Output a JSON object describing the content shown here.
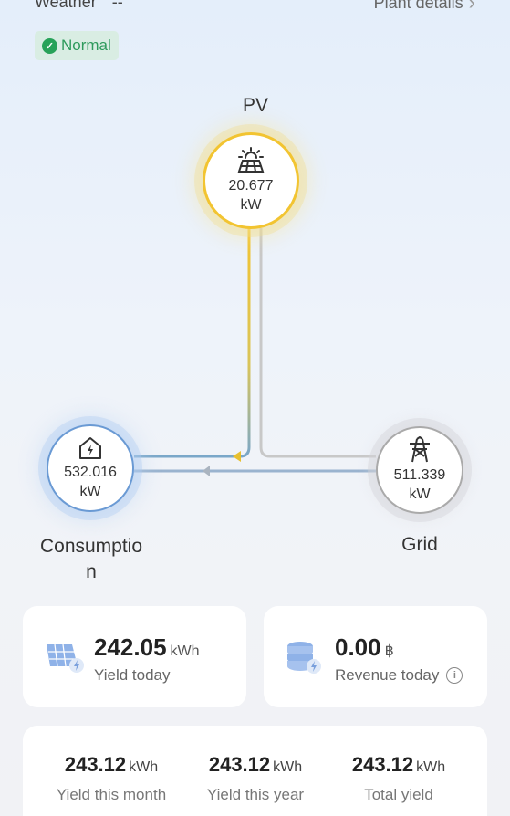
{
  "header": {
    "weather_label": "Weather",
    "weather_value": "--",
    "plant_details_label": "Plant details"
  },
  "status": {
    "label": "Normal",
    "color": "#27a259"
  },
  "flow": {
    "pv": {
      "label": "PV",
      "value": "20.677",
      "unit": "kW",
      "icon": "solar-panel-icon"
    },
    "consumption": {
      "label": "Consumptio",
      "label_wrap": "n",
      "value": "532.016",
      "unit": "kW",
      "icon": "home-power-icon"
    },
    "grid": {
      "label": "Grid",
      "value": "511.339",
      "unit": "kW",
      "icon": "power-tower-icon"
    },
    "colors": {
      "pv": "#f2c431",
      "consumption": "#6a9ad4",
      "grid": "#b5b5b5"
    }
  },
  "stats": {
    "yield_today": {
      "value": "242.05",
      "unit": "kWh",
      "label": "Yield today",
      "icon": "solar-panel-icon"
    },
    "revenue_today": {
      "value": "0.00",
      "unit": "฿",
      "label": "Revenue today",
      "icon": "coin-stack-icon"
    },
    "totals": [
      {
        "value": "243.12",
        "unit": "kWh",
        "label": "Yield this month"
      },
      {
        "value": "243.12",
        "unit": "kWh",
        "label": "Yield this year"
      },
      {
        "value": "243.12",
        "unit": "kWh",
        "label": "Total yield"
      }
    ]
  }
}
